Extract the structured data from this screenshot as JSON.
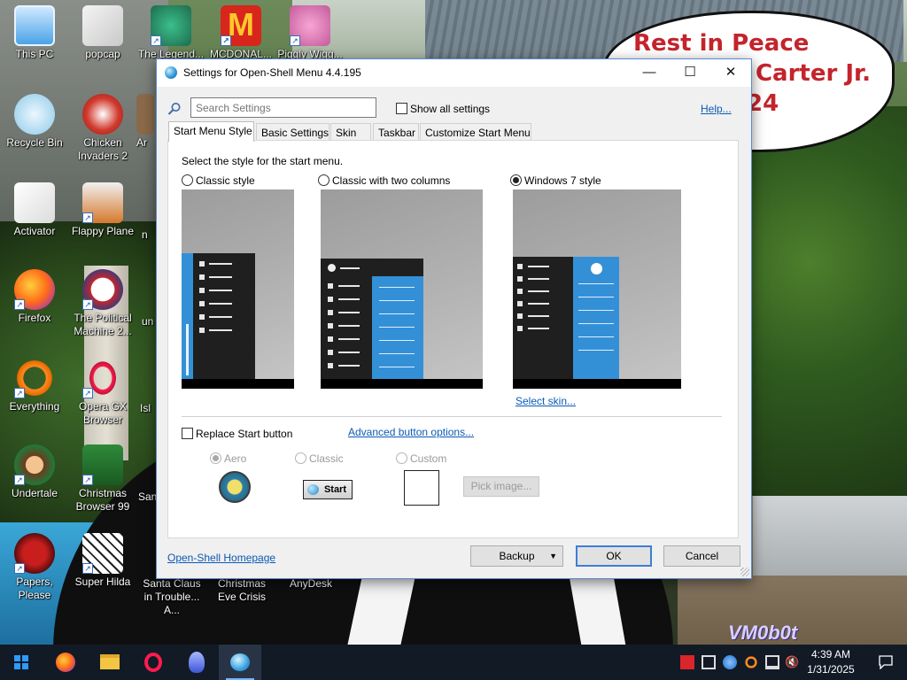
{
  "wallpaper": {
    "speech_lines": [
      "Rest in Peace",
      "l Carter Jr.",
      "24"
    ],
    "watermark": "VM0b0t"
  },
  "desktop_icons": [
    {
      "label": "This PC"
    },
    {
      "label": "popcap"
    },
    {
      "label": "The Legend..."
    },
    {
      "label": "MCDONAL..."
    },
    {
      "label": "Piggly Wigg..."
    },
    {
      "label": "Recycle Bin"
    },
    {
      "label": "Chicken Invaders 2"
    },
    {
      "label": "Ar"
    },
    {
      "label": "Activator"
    },
    {
      "label": "Flappy Plane"
    },
    {
      "label": "n"
    },
    {
      "label": "Firefox"
    },
    {
      "label": "The Political Machine 2..."
    },
    {
      "label": "un"
    },
    {
      "label": "Everything"
    },
    {
      "label": "Opera GX Browser"
    },
    {
      "label": "Isl"
    },
    {
      "label": "Undertale"
    },
    {
      "label": "Christmas Browser 99"
    },
    {
      "label": "San"
    },
    {
      "label": "Papers, Please"
    },
    {
      "label": "Super Hilda"
    },
    {
      "label": "Santa Claus in Trouble... A..."
    },
    {
      "label": "Christmas Eve Crisis"
    },
    {
      "label": "AnyDesk"
    }
  ],
  "window": {
    "title": "Settings for Open-Shell Menu 4.4.195",
    "controls": {
      "minimize": "—",
      "maximize": "☐",
      "close": "✕"
    },
    "search": {
      "placeholder": "Search Settings",
      "value": ""
    },
    "show_all_label": "Show all settings",
    "help_link": "Help...",
    "tabs": [
      {
        "label": "Start Menu Style",
        "active": true
      },
      {
        "label": "Basic Settings",
        "active": false
      },
      {
        "label": "Skin",
        "active": false
      },
      {
        "label": "Taskbar",
        "active": false
      },
      {
        "label": "Customize Start Menu",
        "active": false
      }
    ],
    "style_prompt": "Select the style for the start menu.",
    "styles": [
      {
        "label": "Classic style",
        "selected": false
      },
      {
        "label": "Classic with two columns",
        "selected": false
      },
      {
        "label": "Windows 7 style",
        "selected": true
      }
    ],
    "select_skin_link": "Select skin...",
    "replace_start_label": "Replace Start button",
    "replace_start_checked": false,
    "advanced_button_link": "Advanced button options...",
    "button_styles": [
      {
        "label": "Aero",
        "selected": true
      },
      {
        "label": "Classic",
        "selected": false
      },
      {
        "label": "Custom",
        "selected": false
      }
    ],
    "start_preview_label": "Start",
    "pick_image_label": "Pick image...",
    "homepage_link": "Open-Shell Homepage",
    "backup_label": "Backup",
    "ok_label": "OK",
    "cancel_label": "Cancel"
  },
  "taskbar": {
    "clock_time": "4:39 AM",
    "clock_date": "1/31/2025"
  }
}
